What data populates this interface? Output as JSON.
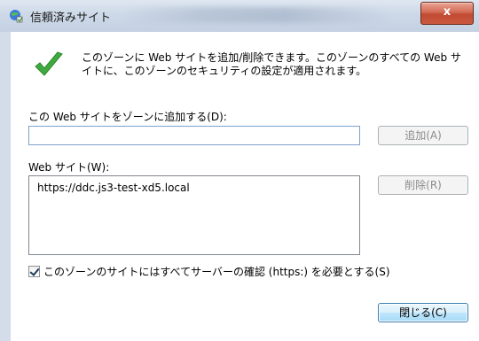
{
  "window": {
    "title": "信頼済みサイト",
    "close_glyph": "x"
  },
  "dialog": {
    "intro_line1": "このゾーンに Web サイトを追加/削除できます。このゾーンのすべての Web サ",
    "intro_line2": "イトに、このゾーンのセキュリティの設定が適用されます。",
    "add_label": "この Web サイトをゾーンに追加する(D):",
    "add_input_value": "",
    "add_button": "追加(A)",
    "sites_label": "Web サイト(W):",
    "sites": [
      "https://ddc.js3-test-xd5.local"
    ],
    "remove_button": "削除(R)",
    "require_https_label": "このゾーンのサイトにはすべてサーバーの確認 (https:) を必要とする(S)",
    "require_https_checked": true,
    "close_button": "閉じる(C)"
  },
  "colors": {
    "check_green": "#3faa3f",
    "close_red": "#c9593f"
  },
  "icons": [
    "trusted-sites-icon",
    "green-checkmark-icon"
  ]
}
